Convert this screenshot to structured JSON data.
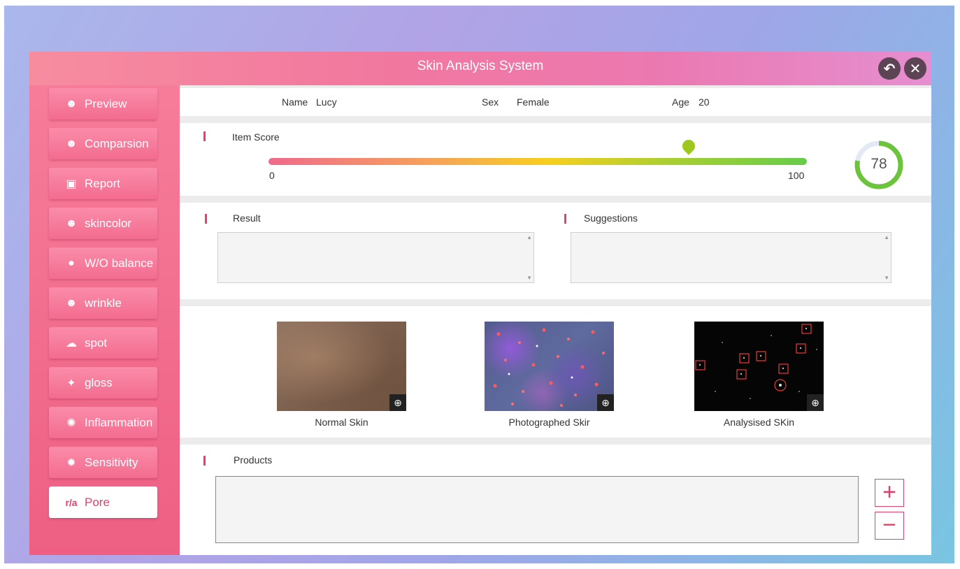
{
  "app": {
    "title": "Skin Analysis System"
  },
  "window_controls": {
    "back_icon": "back-arrow-icon",
    "close_icon": "close-icon",
    "back_glyph": "↶",
    "close_glyph": "✕"
  },
  "sidebar": {
    "items": [
      {
        "label": "Preview",
        "icon": "face-icon",
        "glyph": "☻",
        "active": false
      },
      {
        "label": "Comparsion",
        "icon": "compare-face-icon",
        "glyph": "☻",
        "active": false
      },
      {
        "label": "Report",
        "icon": "report-icon",
        "glyph": "▣",
        "active": false
      },
      {
        "label": "skincolor",
        "icon": "skincolor-face-icon",
        "glyph": "☻",
        "active": false
      },
      {
        "label": "W/O balance",
        "icon": "droplet-icon",
        "glyph": "●",
        "active": false
      },
      {
        "label": "wrinkle",
        "icon": "wrinkle-face-icon",
        "glyph": "☻",
        "active": false
      },
      {
        "label": "spot",
        "icon": "spot-icon",
        "glyph": "☁",
        "active": false
      },
      {
        "label": "gloss",
        "icon": "sparkle-icon",
        "glyph": "✦",
        "active": false
      },
      {
        "label": "Inflammation",
        "icon": "inflammation-icon",
        "glyph": "✺",
        "active": false
      },
      {
        "label": "Sensitivity",
        "icon": "sensitivity-icon",
        "glyph": "✹",
        "active": false
      },
      {
        "label": "Pore",
        "icon": "pore-icon",
        "glyph": "r/a",
        "active": true
      }
    ]
  },
  "patient": {
    "name_label": "Name",
    "name": "Lucy",
    "sex_label": "Sex",
    "sex": "Female",
    "age_label": "Age",
    "age": "20"
  },
  "score": {
    "label": "Item Score",
    "min": "0",
    "max": "100",
    "value": 78,
    "value_text": "78",
    "colors": {
      "ring_fill": "#6bc43c",
      "ring_track": "#e3eaf3",
      "marker": "#9dc81e"
    }
  },
  "result": {
    "label": "Result",
    "text": ""
  },
  "suggestions": {
    "label": "Suggestions",
    "text": ""
  },
  "images": [
    {
      "caption": "Normal Skin",
      "zoom_icon": "zoom-in-icon",
      "zoom_glyph": "⊕"
    },
    {
      "caption": "Photographed Skir",
      "zoom_icon": "zoom-in-icon",
      "zoom_glyph": "⊕"
    },
    {
      "caption": "Analysised SKin",
      "zoom_icon": "zoom-in-icon",
      "zoom_glyph": "⊕"
    }
  ],
  "products": {
    "label": "Products",
    "text": "",
    "add_glyph": "+",
    "remove_glyph": "−"
  },
  "colors": {
    "accent": "#e2416b",
    "sidebar": "#f06d92",
    "title_bar": "#f1779f"
  }
}
